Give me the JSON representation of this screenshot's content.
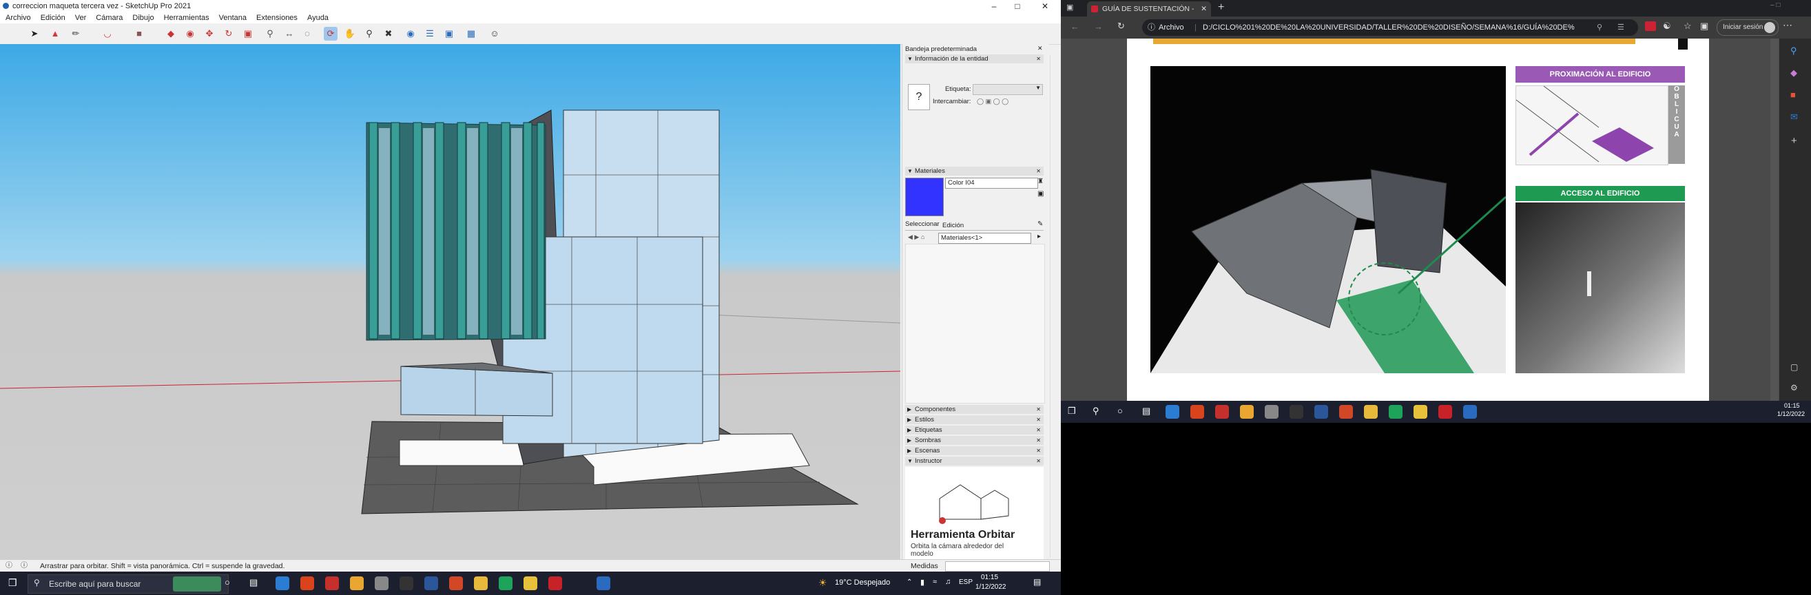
{
  "sketchup": {
    "title": "correccion maqueta tercera vez - SketchUp Pro 2021",
    "menu": [
      "Archivo",
      "Edición",
      "Ver",
      "Cámara",
      "Dibujo",
      "Herramientas",
      "Ventana",
      "Extensiones",
      "Ayuda"
    ],
    "tray": {
      "title": "Bandeja predeterminada",
      "entity_info": "Información de la entidad",
      "etiqueta_label": "Etiqueta:",
      "intercambiar_label": "Intercambiar:",
      "materials_title": "Materiales",
      "material_name": "Color I04",
      "material_color": "#3333ff",
      "tab_select": "Seleccionar",
      "tab_edit": "Edición",
      "materials_dropdown": "Materiales<1>",
      "collapsed_sections": [
        "Componentes",
        "Estilos",
        "Etiquetas",
        "Sombras",
        "Escenas"
      ],
      "instructor_title": "Instructor",
      "tool_name": "Herramienta Orbitar",
      "tool_desc": "Orbita la cámara alrededor del modelo"
    },
    "status_text": "Arrastrar para orbitar. Shift = vista panorámica. Ctrl = suspende la gravedad.",
    "measurements_label": "Medidas"
  },
  "edge": {
    "tab_title": "GUÍA DE SUSTENTACIÓN - CO…",
    "archivo_label": "Archivo",
    "url": "D:/CICLO%201%20DE%20LA%20UNIVERSIDAD/TALLER%20DE%20DISEÑO/SEMANA%16/GUÍA%20DE%…",
    "signin_label": "Iniciar sesión",
    "pdf": {
      "label_proximacion": "PROXIMACIÓN AL EDIFICIO",
      "vertical_letters": [
        "O",
        "B",
        "L",
        "I",
        "C",
        "U",
        "A"
      ],
      "label_acceso": "ACCESO AL EDIFICIO"
    }
  },
  "taskbar_left": {
    "search_placeholder": "Escribe aquí para buscar",
    "weather": "19°C Despejado",
    "lang": "ESP",
    "time": "01:15",
    "date": "1/12/2022"
  },
  "taskbar_right": {
    "time": "01:15",
    "date": "1/12/2022"
  }
}
